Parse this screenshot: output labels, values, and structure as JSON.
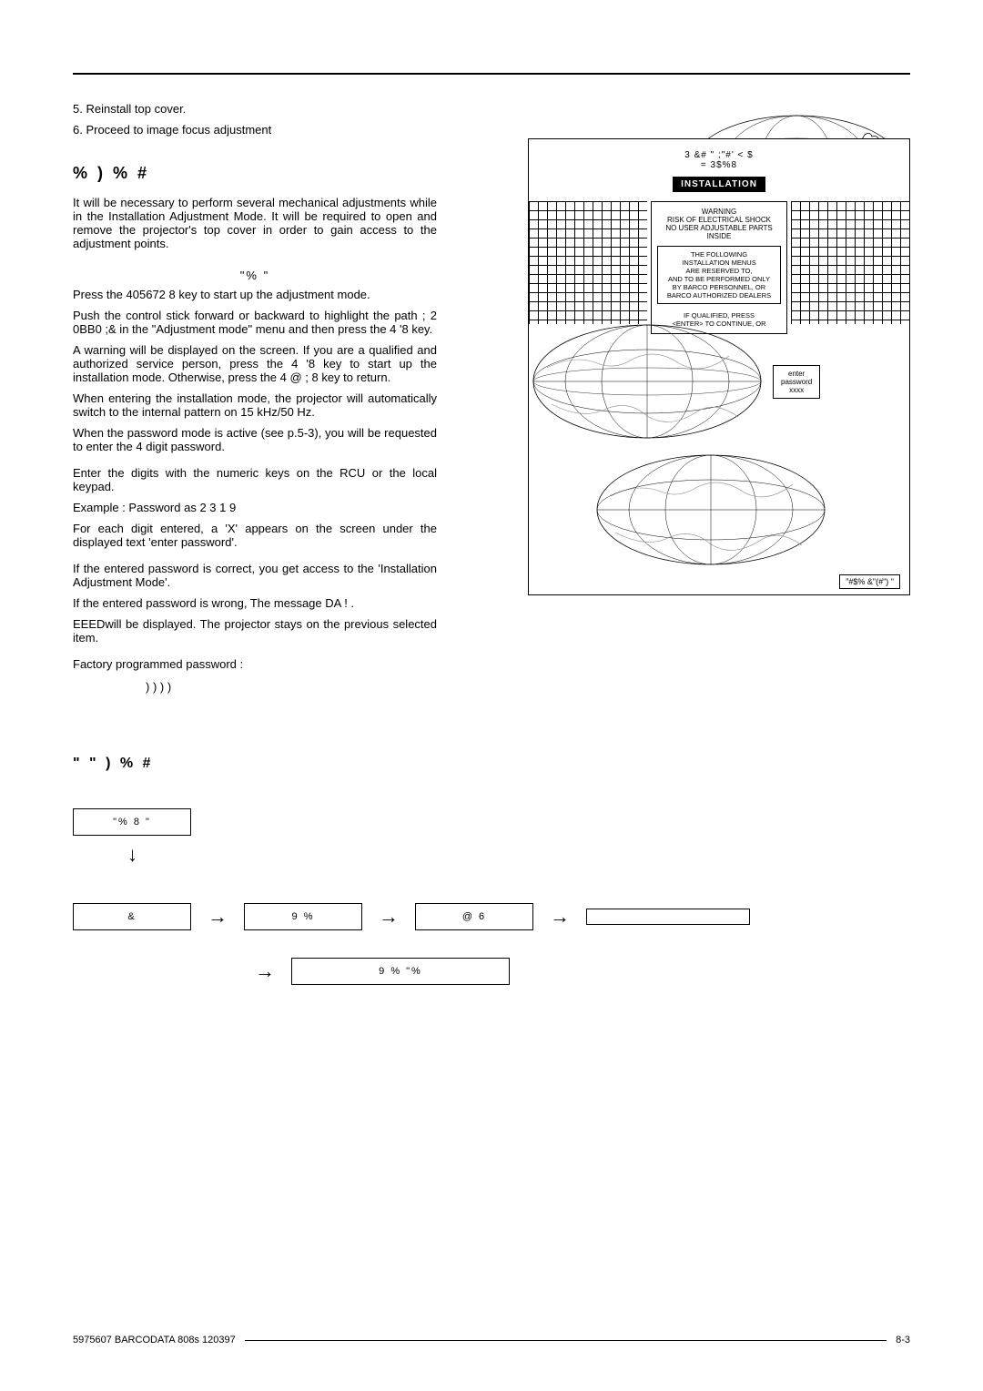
{
  "steps": {
    "s5": "5. Reinstall top cover.",
    "s6": "6. Proceed to image focus adjustment"
  },
  "section_title": "%     )     %     #",
  "intro": "It will be necessary to perform several mechanical adjustments while in the Installation Adjustment Mode. It will be required to open and remove the projector's top cover in order to gain access to the adjustment points.",
  "sub1": "\"%     \"",
  "p1": "Press the 405672 8   key to start up the adjustment mode.",
  "p2": "Push the control stick forward or backward to highlight the path ; 2 0BB0 ;&      in the \"Adjustment mode\" menu and then press the 4    '8       key.",
  "p3": "A warning will be displayed on the screen. If you are a qualified and authorized service person, press the 4    '8       key to start up the installation mode. Otherwise, press the 4 @ ; 8   key to return.",
  "p4": "When entering the installation mode, the projector will automatically switch to the internal pattern on 15 kHz/50 Hz.",
  "p5": "When the password mode is active (see p.5-3), you will be requested to enter the 4 digit password.",
  "p6": "Enter the digits with the numeric keys on the RCU or the local keypad.",
  "p7": "Example :  Password as 2 3 1 9",
  "p8": "For each digit entered, a 'X' appears on the screen under the displayed text 'enter password'.",
  "p9": "If the entered password is correct, you get access to the 'Installation Adjustment Mode'.",
  "p10a": "If the entered password is wrong, The message DA   !   .",
  "p10b": "    EEEDwill be displayed. The projector stays on the previous selected item.",
  "p11": "Factory programmed  password :",
  "p12": ") ) ) )",
  "diagram": {
    "menu_header": "3  &# \" ;\"#' < $\n= 3$%8",
    "installation": "INSTALLATION",
    "warn_title": "WARNING\nRISK OF ELECTRICAL SHOCK\nNO USER ADJUSTABLE PARTS\nINSIDE",
    "warn_sub": "THE FOLLOWING\nINSTALLATION MENUS\nARE RESERVED TO,\nAND TO BE PERFORMED ONLY\nBY BARCO PERSONNEL, OR\nBARCO AUTHORIZED DEALERS",
    "warn_note": "IF QUALIFIED, PRESS\n<ENTER> TO CONTINUE, OR",
    "enter_pwd": "enter\npassword\nxxxx",
    "final": "\"#$%  &\"(#\") \""
  },
  "flow_title": "\"   \"     )     %     #",
  "flow": {
    "b1": "\"%    8 \"",
    "b2": "&",
    "b3": "9  %",
    "b4": "@   6",
    "b5": "",
    "b6": "9  %      \"%"
  },
  "footer": {
    "left": "5975607  BARCODATA 808s 120397",
    "right": "8-3"
  }
}
